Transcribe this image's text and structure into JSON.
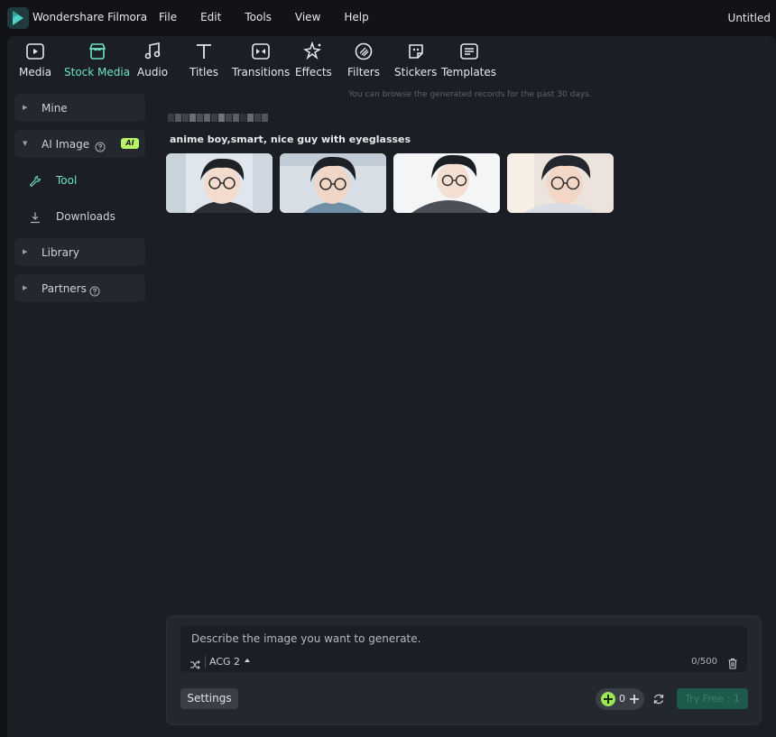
{
  "app": {
    "name": "Wondershare Filmora",
    "document_title": "Untitled",
    "menu": [
      "File",
      "Edit",
      "Tools",
      "View",
      "Help"
    ]
  },
  "toolbar": {
    "items": [
      {
        "label": "Media",
        "icon": "media-icon"
      },
      {
        "label": "Stock Media",
        "icon": "stock-media-icon",
        "active": true
      },
      {
        "label": "Audio",
        "icon": "music-note-icon"
      },
      {
        "label": "Titles",
        "icon": "text-t-icon"
      },
      {
        "label": "Transitions",
        "icon": "transitions-icon"
      },
      {
        "label": "Effects",
        "icon": "sparkle-icon"
      },
      {
        "label": "Filters",
        "icon": "filter-icon"
      },
      {
        "label": "Stickers",
        "icon": "sticker-icon"
      },
      {
        "label": "Templates",
        "icon": "templates-icon"
      }
    ],
    "accent_color": "#6ee3c7"
  },
  "sidebar": {
    "mine": "Mine",
    "ai_image": "AI Image",
    "ai_badge": "AI",
    "tool": "Tool",
    "downloads": "Downloads",
    "library": "Library",
    "partners": "Partners"
  },
  "main": {
    "notice": "You can browse the generated records for the past 30 days.",
    "prompt_title": "anime boy,smart, nice guy with eyeglasses",
    "thumbnails": [
      {
        "name": "generated-image-1"
      },
      {
        "name": "generated-image-2"
      },
      {
        "name": "generated-image-3"
      },
      {
        "name": "generated-image-4"
      }
    ]
  },
  "generator": {
    "placeholder": "Describe the image you want to generate.",
    "style": "ACG 2",
    "char_count": "0/500",
    "settings_label": "Settings",
    "credits": "0",
    "try_free_label": "Try Free : 1"
  }
}
